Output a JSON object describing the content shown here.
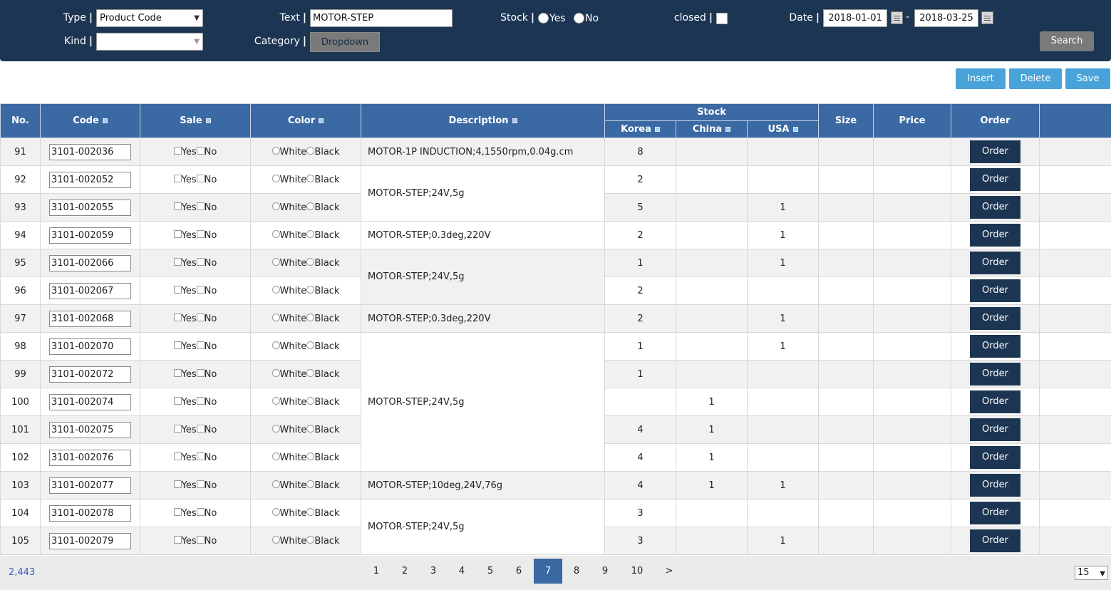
{
  "filter": {
    "type_label": "Type",
    "type_value": "Product Code",
    "kind_label": "Kind",
    "kind_value": "",
    "text_label": "Text",
    "text_value": "MOTOR-STEP",
    "category_label": "Category",
    "category_button": "Dropdown",
    "stock_label": "Stock",
    "stock_yes": "Yes",
    "stock_no": "No",
    "closed_label": "closed",
    "date_label": "Date",
    "date_from": "2018-01-01",
    "date_sep": "-",
    "date_to": "2018-03-25",
    "search_button": "Search",
    "separator": "|"
  },
  "actions": {
    "insert": "Insert",
    "delete": "Delete",
    "save": "Save"
  },
  "columns": {
    "no": "No.",
    "code": "Code",
    "sale": "Sale",
    "color": "Color",
    "description": "Description",
    "stock": "Stock",
    "korea": "Korea",
    "china": "China",
    "usa": "USA",
    "size": "Size",
    "price": "Price",
    "order": "Order"
  },
  "options": {
    "yes": "Yes",
    "no": "No",
    "white": "White",
    "black": "Black",
    "order_button": "Order"
  },
  "rows": [
    {
      "no": "91",
      "code": "3101-002036",
      "korea": "8",
      "china": "",
      "usa": ""
    },
    {
      "no": "92",
      "code": "3101-002052",
      "korea": "2",
      "china": "",
      "usa": ""
    },
    {
      "no": "93",
      "code": "3101-002055",
      "korea": "5",
      "china": "",
      "usa": "1"
    },
    {
      "no": "94",
      "code": "3101-002059",
      "korea": "2",
      "china": "",
      "usa": "1"
    },
    {
      "no": "95",
      "code": "3101-002066",
      "korea": "1",
      "china": "",
      "usa": "1"
    },
    {
      "no": "96",
      "code": "3101-002067",
      "korea": "2",
      "china": "",
      "usa": ""
    },
    {
      "no": "97",
      "code": "3101-002068",
      "korea": "2",
      "china": "",
      "usa": "1"
    },
    {
      "no": "98",
      "code": "3101-002070",
      "korea": "1",
      "china": "",
      "usa": "1"
    },
    {
      "no": "99",
      "code": "3101-002072",
      "korea": "1",
      "china": "",
      "usa": ""
    },
    {
      "no": "100",
      "code": "3101-002074",
      "korea": "",
      "china": "1",
      "usa": ""
    },
    {
      "no": "101",
      "code": "3101-002075",
      "korea": "4",
      "china": "1",
      "usa": ""
    },
    {
      "no": "102",
      "code": "3101-002076",
      "korea": "4",
      "china": "1",
      "usa": ""
    },
    {
      "no": "103",
      "code": "3101-002077",
      "korea": "4",
      "china": "1",
      "usa": "1"
    },
    {
      "no": "104",
      "code": "3101-002078",
      "korea": "3",
      "china": "",
      "usa": ""
    },
    {
      "no": "105",
      "code": "3101-002079",
      "korea": "3",
      "china": "",
      "usa": "1"
    }
  ],
  "descriptions": [
    {
      "text": "MOTOR-1P INDUCTION;4,1550rpm,0.04g.cm",
      "rows": 1
    },
    {
      "text": "MOTOR-STEP;24V,5g",
      "rows": 2
    },
    {
      "text": "MOTOR-STEP;0.3deg,220V",
      "rows": 1
    },
    {
      "text": "MOTOR-STEP;24V,5g",
      "rows": 2
    },
    {
      "text": "MOTOR-STEP;0.3deg,220V",
      "rows": 1
    },
    {
      "text": "MOTOR-STEP;24V,5g",
      "rows": 5
    },
    {
      "text": "MOTOR-STEP;10deg,24V,76g",
      "rows": 1
    },
    {
      "text": "MOTOR-STEP;24V,5g",
      "rows": 2
    }
  ],
  "pagination": {
    "total": "2,443",
    "pages": [
      "1",
      "2",
      "3",
      "4",
      "5",
      "6",
      "7",
      "8",
      "9",
      "10"
    ],
    "current": "7",
    "next": ">",
    "page_size": "15"
  },
  "colors": {
    "header_bg": "#1c3553",
    "table_header": "#3a69a3",
    "action_button": "#4aa3d8",
    "order_button": "#1c3553"
  }
}
